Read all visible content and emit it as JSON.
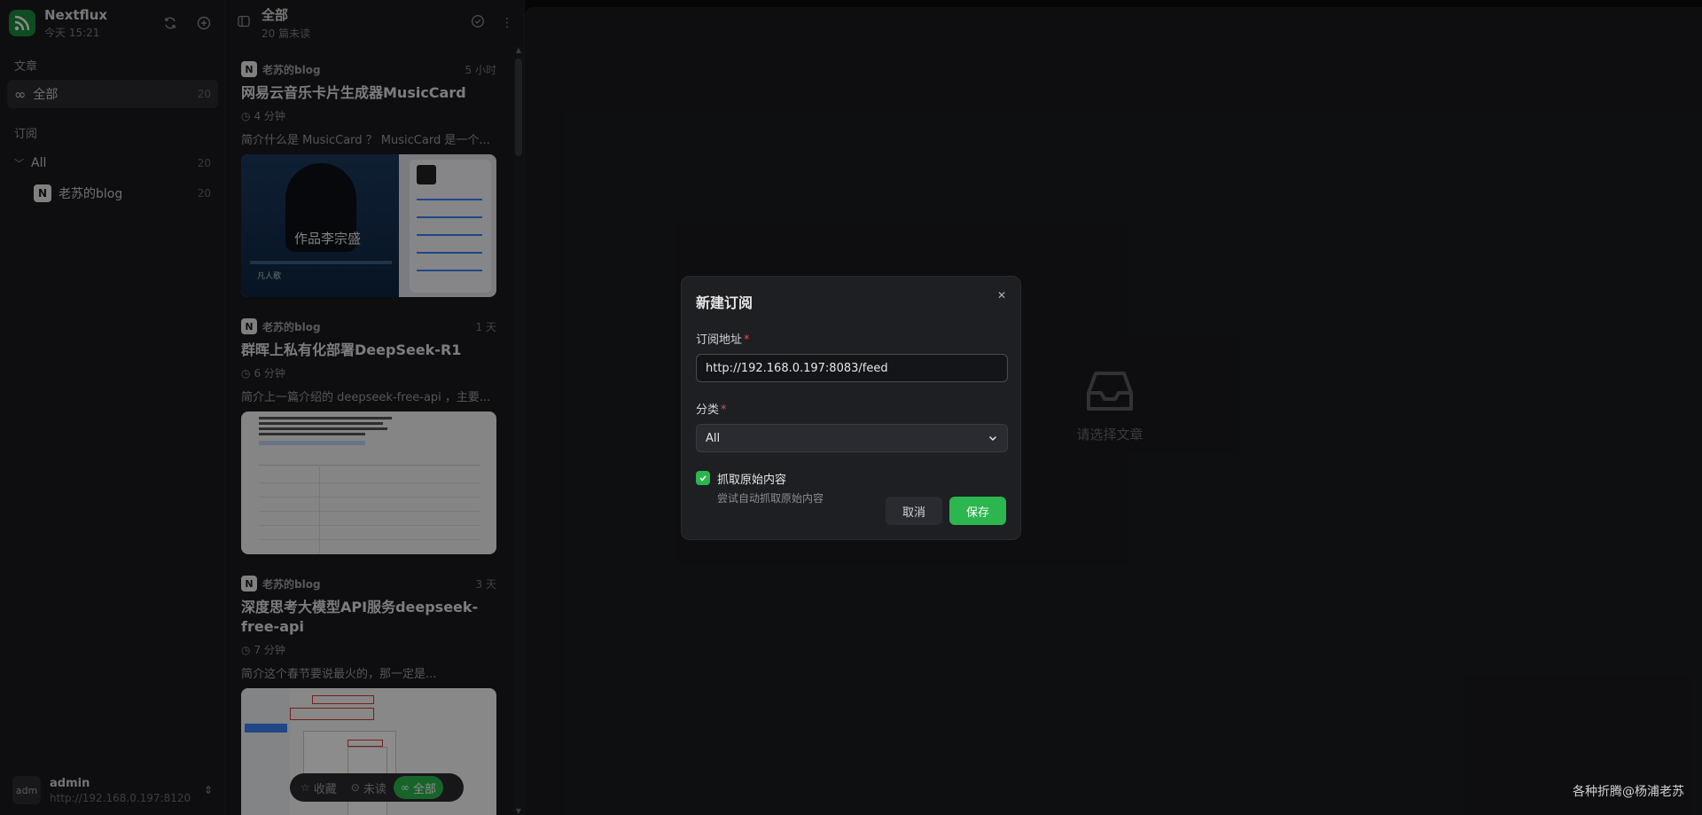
{
  "app": {
    "name": "Nextflux",
    "time": "今天 15:21"
  },
  "sidebar": {
    "articles_label": "文章",
    "all_label": "全部",
    "all_count": "20",
    "subscriptions_label": "订阅",
    "groups": [
      {
        "label": "All",
        "count": "20"
      }
    ],
    "feeds": [
      {
        "label": "老苏的blog",
        "count": "20",
        "icon_letter": "N"
      }
    ]
  },
  "user": {
    "avatar": "adm",
    "name": "admin",
    "url": "http://192.168.0.197:8120"
  },
  "list": {
    "title": "全部",
    "subtitle": "20 篇未读",
    "articles": [
      {
        "source": "老苏的blog",
        "time": "5 小时",
        "title": "网易云音乐卡片生成器MusicCard",
        "read_time": "4 分钟",
        "summary": "简介什么是 MusicCard ？ MusicCard 是一个..."
      },
      {
        "source": "老苏的blog",
        "time": "1 天",
        "title": "群晖上私有化部署DeepSeek-R1",
        "read_time": "6 分钟",
        "summary": "简介上一篇介绍的 deepseek-free-api ，主要..."
      },
      {
        "source": "老苏的blog",
        "time": "3 天",
        "title": "深度思考大模型API服务deepseek-free-api",
        "read_time": "7 分钟",
        "summary": "简介这个春节要说最火的，那一定是..."
      }
    ],
    "thumb_text": {
      "card_overlay": "作品李宗盛",
      "card_name": "凡人歌"
    },
    "filters": [
      {
        "label": "收藏"
      },
      {
        "label": "未读"
      },
      {
        "label": "全部"
      }
    ]
  },
  "content": {
    "empty_text": "请选择文章",
    "watermark": "各种折腾@杨浦老苏"
  },
  "modal": {
    "title": "新建订阅",
    "url_label": "订阅地址",
    "url_value": "http://192.168.0.197:8083/feed",
    "category_label": "分类",
    "category_value": "All",
    "crawler_label": "抓取原始内容",
    "crawler_desc": "尝试自动抓取原始内容",
    "cancel": "取消",
    "save": "保存"
  },
  "colors": {
    "accent": "#2bb64f",
    "brand": "#1d8a3c",
    "required": "#e5484d"
  }
}
